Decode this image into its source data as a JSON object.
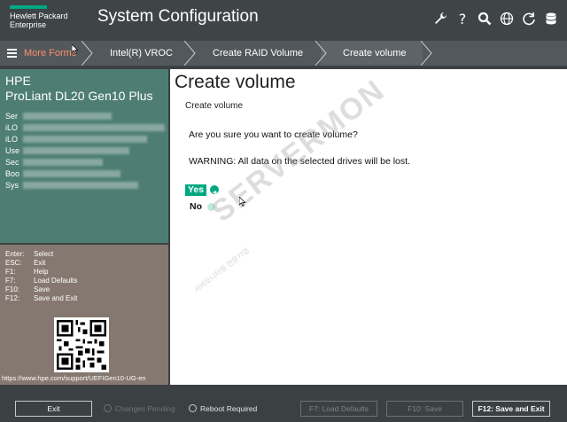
{
  "header": {
    "brand_line1": "Hewlett Packard",
    "brand_line2": "Enterprise",
    "title": "System Configuration",
    "icons": [
      "wrench-icon",
      "help-icon",
      "search-icon",
      "globe-icon",
      "refresh-icon",
      "database-icon"
    ]
  },
  "breadcrumb": {
    "more_forms": "More Forms",
    "items": [
      "Intel(R) VROC",
      "Create RAID Volume",
      "Create volume"
    ]
  },
  "server": {
    "brand": "HPE",
    "model": "ProLiant DL20 Gen10 Plus",
    "info_labels": [
      "Ser",
      "iLO",
      "iLO",
      "Use",
      "Sec",
      "Boo",
      "Sys"
    ]
  },
  "keys": [
    {
      "key": "Enter:",
      "action": "Select"
    },
    {
      "key": "ESC:",
      "action": "Exit"
    },
    {
      "key": "F1:",
      "action": "Help"
    },
    {
      "key": "F7:",
      "action": "Load Defaults"
    },
    {
      "key": "F10:",
      "action": "Save"
    },
    {
      "key": "F12:",
      "action": "Save and Exit"
    }
  ],
  "help_url": "https://www.hpe.com/support/UEFIGen10-UG-en",
  "main": {
    "page_title": "Create volume",
    "form_title": "Create volume",
    "question": "Are you sure you want to create volume?",
    "warning": "WARNING: All data on the selected drives will be lost.",
    "options": [
      "Yes",
      "No"
    ],
    "selected_option": "Yes"
  },
  "watermark": {
    "text": "SERVERMON",
    "subtext": "서버모니터링 전문기업"
  },
  "footer": {
    "exit": "Exit",
    "changes_pending": "Changes Pending",
    "reboot_required": "Reboot Required",
    "load_defaults": "F7: Load Defaults",
    "save": "F10: Save",
    "save_exit": "F12: Save and Exit"
  },
  "colors": {
    "accent": "#01a982",
    "more_forms": "#ff8d6d",
    "info_panel": "#4e7e73",
    "keys_panel": "#857870"
  }
}
